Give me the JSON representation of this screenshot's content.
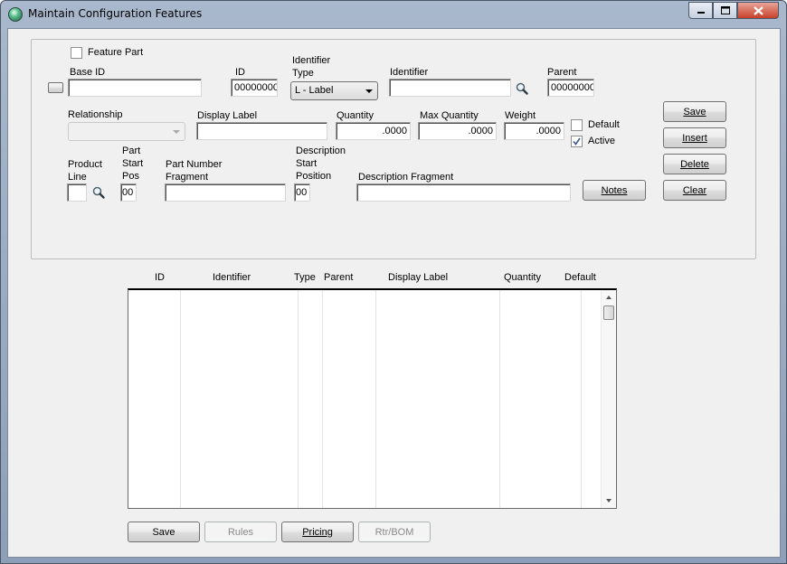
{
  "window": {
    "title": "Maintain Configuration Features"
  },
  "form": {
    "feature_part_label": "Feature Part",
    "base_id_label": "Base ID",
    "base_id_value": "",
    "id_label": "ID",
    "id_value": "00000000",
    "identifier_type_label_1": "Identifier",
    "identifier_type_label_2": "Type",
    "identifier_type_value": "L - Label",
    "identifier_label": "Identifier",
    "identifier_value": "",
    "parent_label": "Parent",
    "parent_value": "00000000",
    "relationship_label": "Relationship",
    "relationship_value": "",
    "display_label_label": "Display Label",
    "display_label_value": "",
    "quantity_label": "Quantity",
    "quantity_value": ".0000",
    "max_quantity_label": "Max Quantity",
    "max_quantity_value": ".0000",
    "weight_label": "Weight",
    "weight_value": ".0000",
    "default_label": "Default",
    "default_checked": false,
    "active_label": "Active",
    "active_checked": true,
    "product_line_label_1": "Product",
    "product_line_label_2": "Line",
    "product_line_value": "",
    "part_start_pos_label_1": "Part",
    "part_start_pos_label_2": "Start",
    "part_start_pos_label_3": "Pos",
    "part_start_pos_value": "00",
    "part_number_fragment_label_1": "Part Number",
    "part_number_fragment_label_2": "Fragment",
    "part_number_fragment_value": "",
    "desc_start_pos_label_1": "Description",
    "desc_start_pos_label_2": "Start",
    "desc_start_pos_label_3": "Position",
    "desc_start_pos_value": "00",
    "description_fragment_label": "Description Fragment",
    "description_fragment_value": ""
  },
  "side_buttons": {
    "save": "Save",
    "insert": "Insert",
    "delete": "Delete",
    "clear": "Clear",
    "notes": "Notes"
  },
  "grid": {
    "columns": [
      "ID",
      "Identifier",
      "Type",
      "Parent",
      "Display Label",
      "Quantity",
      "Default"
    ],
    "rows": []
  },
  "bottom_buttons": {
    "save": "Save",
    "rules": "Rules",
    "pricing": "Pricing",
    "rtr_bom": "Rtr/BOM"
  },
  "icons": {
    "search": "magnifier-icon",
    "app": "app-globe-icon"
  }
}
